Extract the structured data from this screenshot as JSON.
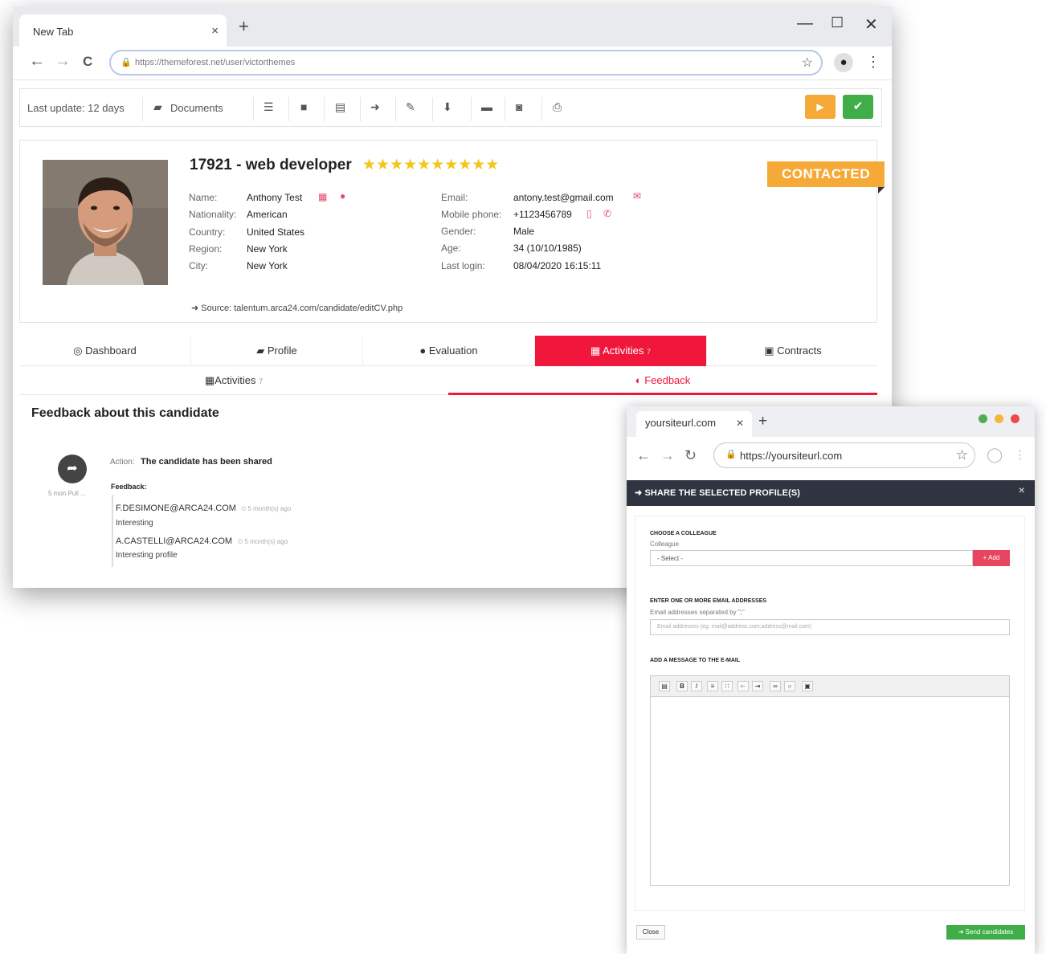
{
  "browser": {
    "tab_title": "New Tab",
    "tab_close": "×",
    "new_tab": "+",
    "minimize": "—",
    "maximize": "☐",
    "close": "✕",
    "back": "←",
    "forward": "→",
    "reload": "C",
    "url": "https://themeforest.net/user/victorthemes"
  },
  "toolbar": {
    "last_update": "Last update: 12 days",
    "documents": "Documents"
  },
  "candidate": {
    "title": "17921 - web developer",
    "stars": "★★★★★★★★★★",
    "status": "CONTACTED",
    "fields_left": [
      {
        "label": "Name:",
        "value": "Anthony Test"
      },
      {
        "label": "Nationality:",
        "value": "American"
      },
      {
        "label": "Country:",
        "value": "United States"
      },
      {
        "label": "Region:",
        "value": "New York"
      },
      {
        "label": "City:",
        "value": "New York"
      }
    ],
    "fields_right": [
      {
        "label": "Email:",
        "value": "antony.test@gmail.com"
      },
      {
        "label": "Mobile phone:",
        "value": "+1123456789"
      },
      {
        "label": "Gender:",
        "value": "Male"
      },
      {
        "label": "Age:",
        "value": "34 (10/10/1985)"
      },
      {
        "label": "Last login:",
        "value": "08/04/2020 16:15:11"
      }
    ],
    "source": "Source: talentum.arca24.com/candidate/editCV.php"
  },
  "tabs_main": [
    {
      "label": "Dashboard"
    },
    {
      "label": "Profile"
    },
    {
      "label": "Evaluation"
    },
    {
      "label": "Activities",
      "count": "7"
    },
    {
      "label": "Contracts"
    }
  ],
  "tabs_sub": [
    {
      "label": "Activities",
      "count": "7"
    },
    {
      "label": "Feedback"
    }
  ],
  "feedback": {
    "title": "Feedback about this candidate",
    "meta": "5 mon Pull ...",
    "action_label": "Action:",
    "action_text": "The candidate has been shared",
    "feedback_label": "Feedback:",
    "entries": [
      {
        "author": "F.DESIMONE@ARCA24.COM",
        "time": "5 month(s) ago",
        "message": "Interesting"
      },
      {
        "author": "A.CASTELLI@ARCA24.COM",
        "time": "5 month(s) ago",
        "message": "Interesting profile"
      }
    ]
  },
  "popup": {
    "tab_title": "yoursiteurl.com",
    "url": "https://yoursiteurl.com",
    "header": "SHARE THE SELECTED PROFILE(S)",
    "choose_title": "CHOOSE A COLLEAGUE",
    "colleague_label": "Colleague",
    "select_value": "- Select -",
    "add_label": "+ Add",
    "emails_title": "ENTER ONE OR MORE EMAIL ADDRESSES",
    "emails_hint": "Email addresses separated by \";\"",
    "emails_placeholder": "Email addresses (eg. mail@address.com;address@mail.com)",
    "message_title": "ADD A MESSAGE TO THE E-MAIL",
    "close_label": "Close",
    "send_label": "Send candidates"
  },
  "colors": {
    "accent_red": "#f0163c",
    "orange": "#f5a937",
    "green": "#3fae49",
    "modal_header": "#2f3440"
  }
}
